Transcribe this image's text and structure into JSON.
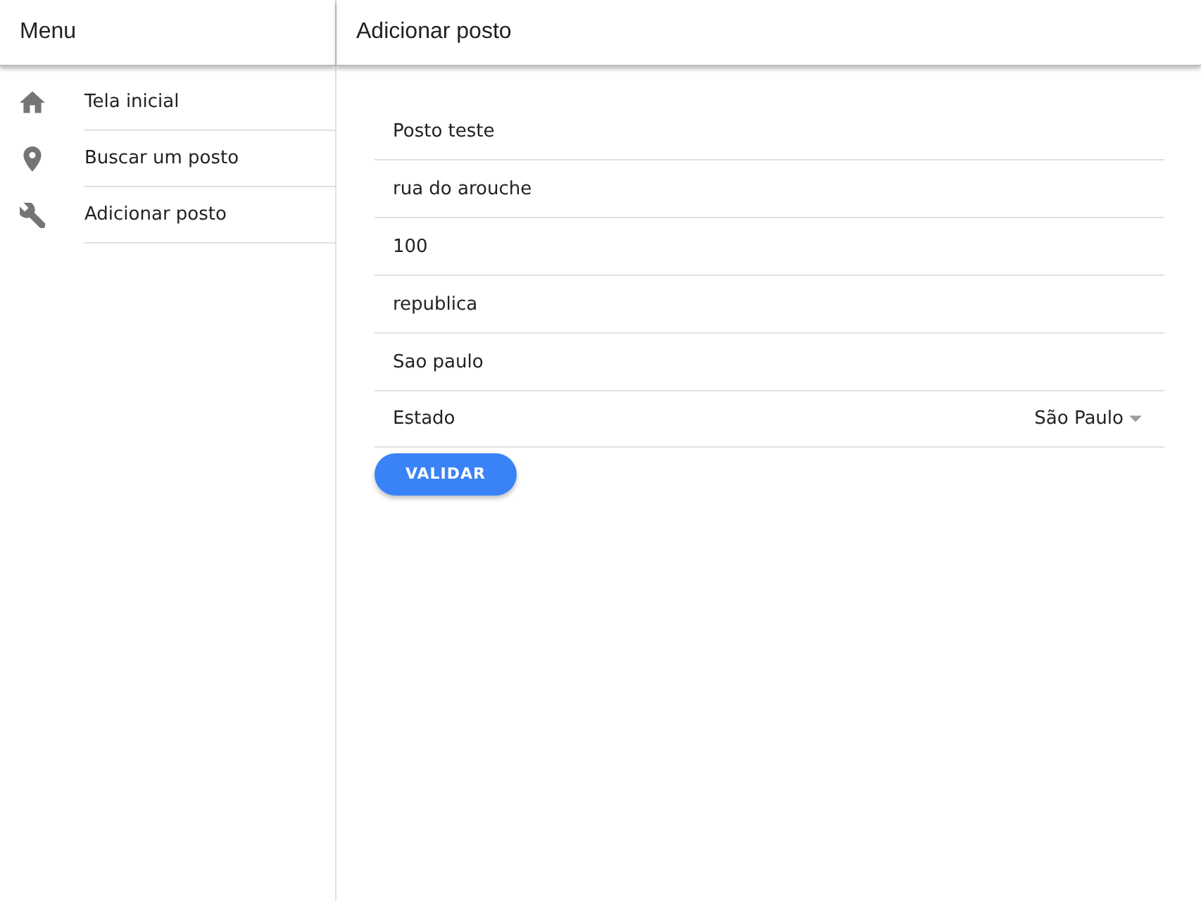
{
  "sidebar": {
    "title": "Menu",
    "items": [
      {
        "kind": "home",
        "label": "Tela inicial"
      },
      {
        "kind": "pin",
        "label": "Buscar um posto"
      },
      {
        "kind": "wrench",
        "label": "Adicionar posto"
      }
    ]
  },
  "page": {
    "title": "Adicionar posto"
  },
  "form": {
    "fields": [
      {
        "kind": "text",
        "value": "Posto teste"
      },
      {
        "kind": "text",
        "value": "rua do arouche"
      },
      {
        "kind": "text",
        "value": "100"
      },
      {
        "kind": "text",
        "value": "republica"
      },
      {
        "kind": "text",
        "value": "Sao paulo"
      },
      {
        "kind": "select",
        "label": "Estado",
        "value": "São Paulo"
      }
    ],
    "submit": "VALIDAR"
  }
}
